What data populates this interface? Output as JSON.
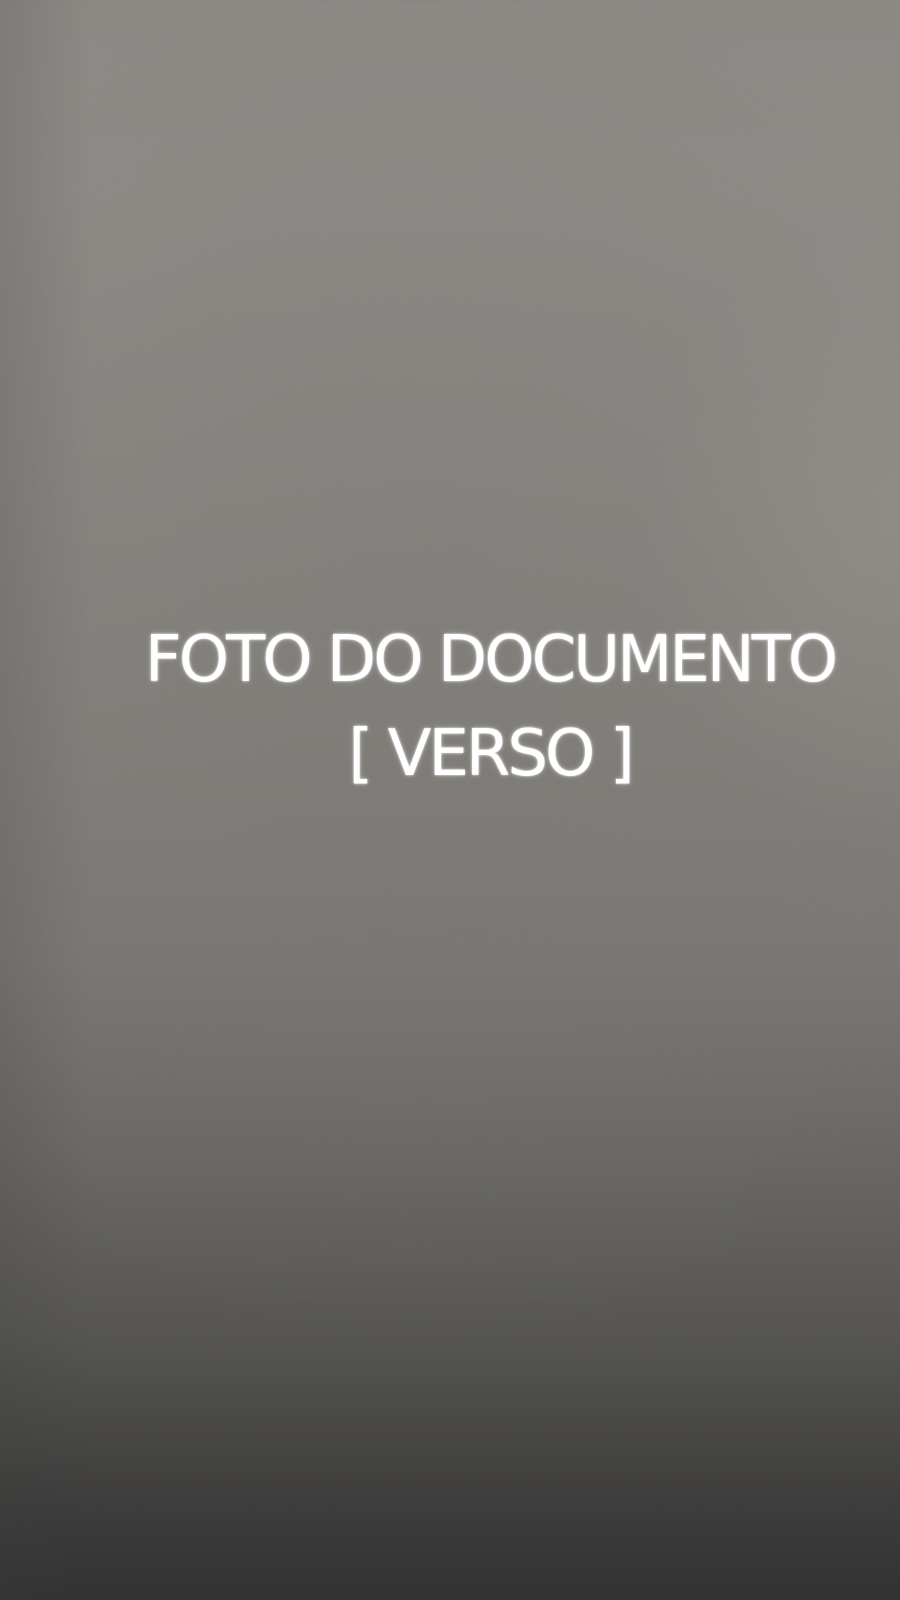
{
  "screen": {
    "title_line": "FOTO DO DOCUMENTO",
    "subtitle_line": "[ VERSO ]"
  },
  "colors": {
    "text": "#ffffff",
    "background_top": "#8c8985",
    "background_bottom": "#333232"
  }
}
